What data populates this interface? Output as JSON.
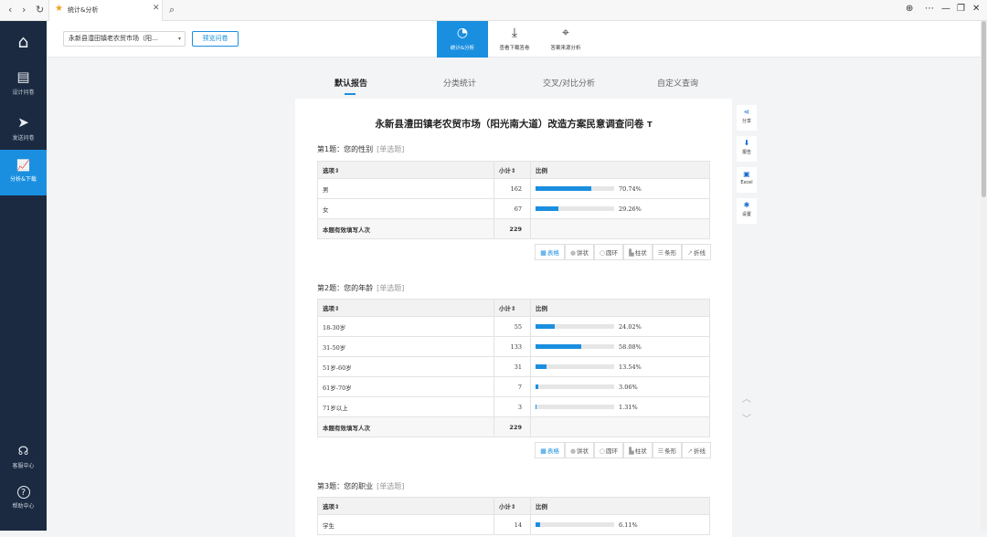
{
  "browser": {
    "back": "‹",
    "forward": "›",
    "reload": "↻",
    "tab_title": "统计&分析",
    "tab_close": "✕",
    "search": "⌕",
    "globe": "⊕",
    "more": "⋯",
    "minimize": "—",
    "restore": "❐",
    "close": "✕"
  },
  "sidebar": {
    "items": [
      {
        "icon": "home-icon",
        "glyph": "⌂",
        "label": ""
      },
      {
        "icon": "document-icon",
        "glyph": "▤",
        "label": "设计问卷"
      },
      {
        "icon": "send-icon",
        "glyph": "➤",
        "label": "发送问卷"
      },
      {
        "icon": "chart-icon",
        "glyph": "📈",
        "label": "分析&下载"
      },
      {
        "icon": "headset-icon",
        "glyph": "☊",
        "label": "客服中心"
      },
      {
        "icon": "help-icon",
        "glyph": "?",
        "label": "帮助中心"
      }
    ]
  },
  "topbar": {
    "survey_select": "永新县澧田镇老农贸市场（阳…",
    "caret": "▾",
    "preview_label": "预览问卷",
    "tabs": [
      {
        "icon": "pie-icon",
        "glyph": "◔",
        "label": "统计&分析"
      },
      {
        "icon": "download-icon",
        "glyph": "⤓",
        "label": "查看下载答卷"
      },
      {
        "icon": "target-icon",
        "glyph": "⌖",
        "label": "答案来源分析"
      }
    ]
  },
  "subtabs": [
    "默认报告",
    "分类统计",
    "交叉/对比分析",
    "自定义查询"
  ],
  "survey_title": "永新县澧田镇老农贸市场（阳光南大道）改造方案民意调查问卷",
  "survey_title_icon": "T",
  "table_headers": {
    "option": "选项⇕",
    "count": "小计⇕",
    "ratio": "比例"
  },
  "total_label": "本题有效填写人次",
  "toolbar": [
    {
      "icon": "table-icon",
      "glyph": "▦",
      "label": "表格"
    },
    {
      "icon": "pie-icon",
      "glyph": "●",
      "label": "饼状"
    },
    {
      "icon": "ring-icon",
      "glyph": "○",
      "label": "圆环"
    },
    {
      "icon": "column-icon",
      "glyph": "▙",
      "label": "柱状"
    },
    {
      "icon": "bar-icon",
      "glyph": "☰",
      "label": "条形"
    },
    {
      "icon": "line-icon",
      "glyph": "↗",
      "label": "折线"
    }
  ],
  "questions": [
    {
      "title": "第1题：您的性别",
      "type": "[单选题]",
      "rows": [
        {
          "option": "男",
          "count": "162",
          "fraction": 0.7074,
          "pct": "70.74%"
        },
        {
          "option": "女",
          "count": "67",
          "fraction": 0.2926,
          "pct": "29.26%"
        }
      ],
      "total": "229"
    },
    {
      "title": "第2题：您的年龄",
      "type": "[单选题]",
      "rows": [
        {
          "option": "18-30岁",
          "count": "55",
          "fraction": 0.2402,
          "pct": "24.02%"
        },
        {
          "option": "31-50岁",
          "count": "133",
          "fraction": 0.5808,
          "pct": "58.08%"
        },
        {
          "option": "51岁-60岁",
          "count": "31",
          "fraction": 0.1354,
          "pct": "13.54%"
        },
        {
          "option": "61岁-70岁",
          "count": "7",
          "fraction": 0.0306,
          "pct": "3.06%"
        },
        {
          "option": "71岁以上",
          "count": "3",
          "fraction": 0.0131,
          "pct": "1.31%"
        }
      ],
      "total": "229"
    },
    {
      "title": "第3题：您的职业",
      "type": "[单选题]",
      "rows": [
        {
          "option": "学生",
          "count": "14",
          "fraction": 0.0611,
          "pct": "6.11%"
        }
      ]
    }
  ],
  "right_tools": [
    {
      "icon": "share-icon",
      "glyph": "⋖",
      "label": "分享"
    },
    {
      "icon": "download-icon",
      "glyph": "⬇",
      "label": "报告"
    },
    {
      "icon": "excel-icon",
      "glyph": "▣",
      "label": "Excel"
    },
    {
      "icon": "settings-icon",
      "glyph": "✱",
      "label": "设置"
    }
  ],
  "scroll_up": "︿",
  "scroll_down": "﹀",
  "colors": {
    "accent": "#1a8fe0",
    "sidebar": "#1b2a41"
  }
}
